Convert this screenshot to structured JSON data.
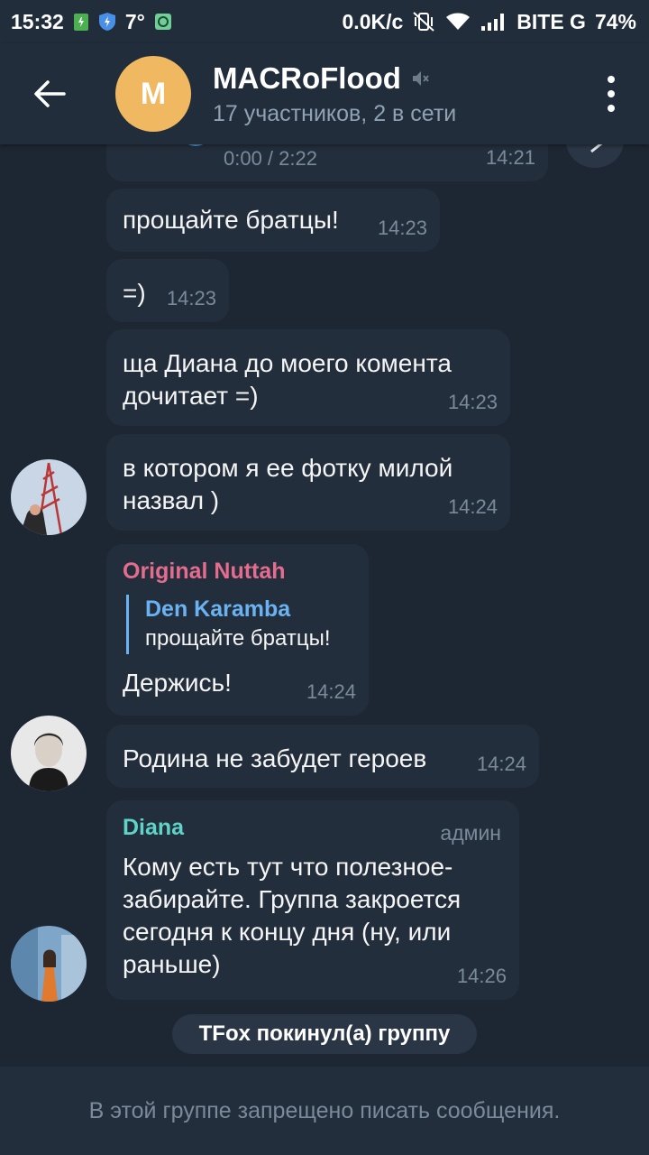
{
  "status_bar": {
    "time": "15:32",
    "temperature": "7°",
    "network_speed": "0.0K/c",
    "carrier": "BITE G",
    "battery": "74%"
  },
  "header": {
    "avatar_letter": "M",
    "title": "MACRoFlood",
    "subtitle": "17 участников, 2 в сети",
    "avatar_color": "#f0b860"
  },
  "messages": [
    {
      "audio_progress": "0:00 / 2:22",
      "time": "14:21"
    },
    {
      "text": "прощайте братцы!",
      "time": "14:23"
    },
    {
      "text": "=)",
      "time": "14:23"
    },
    {
      "text": "ща Диана до моего комента дочитает =)",
      "time": "14:23"
    },
    {
      "text": "в котором я ее фотку милой назвал )",
      "time": "14:24"
    },
    {
      "sender": "Original Nuttah",
      "reply_name": "Den Karamba",
      "reply_text": "прощайте братцы!",
      "text": "Держись!",
      "time": "14:24"
    },
    {
      "text": "Родина не забудет героев",
      "time": "14:24"
    },
    {
      "sender": "Diana",
      "badge": "админ",
      "text": "Кому есть тут что полезное- забирайте. Группа закроется сегодня к концу дня (ну, или раньше)",
      "time": "14:26"
    }
  ],
  "service_message": "TFox покинул(а) группу",
  "bottom_notice": "В этой группе запрещено писать сообщения.",
  "colors": {
    "background": "#1d2733",
    "bubble": "#232e3c",
    "sender_original_nuttah": "#e56c8d",
    "sender_diana": "#5fd3c8",
    "reply_accent": "#6ab2f2"
  }
}
